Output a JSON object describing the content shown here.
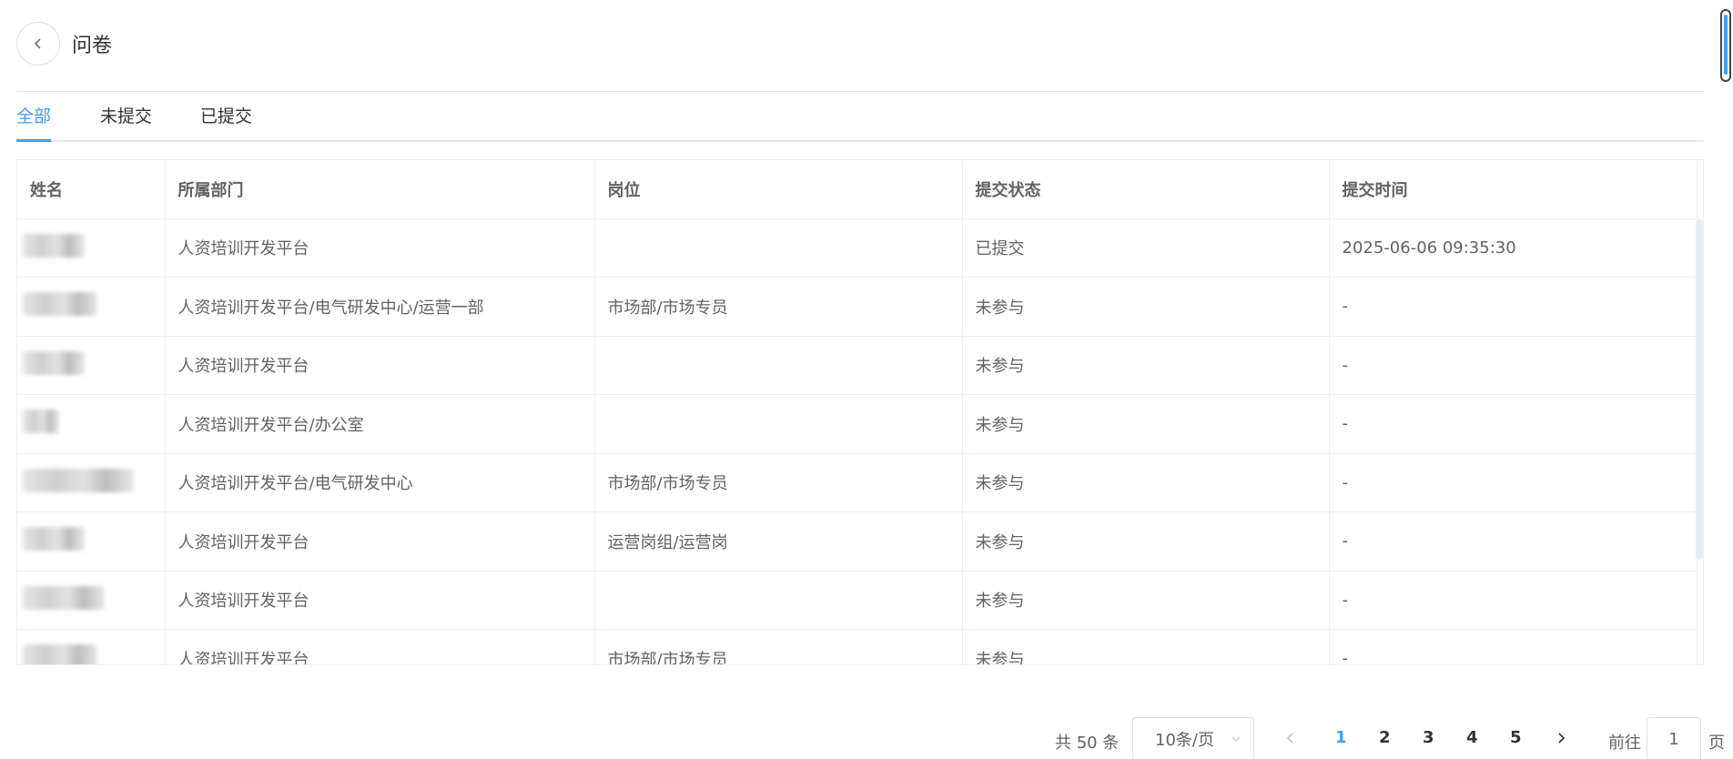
{
  "header": {
    "title": "问卷"
  },
  "tabs": [
    {
      "label": "全部",
      "active": true
    },
    {
      "label": "未提交",
      "active": false
    },
    {
      "label": "已提交",
      "active": false
    }
  ],
  "table": {
    "columns": [
      "姓名",
      "所属部门",
      "岗位",
      "提交状态",
      "提交时间"
    ],
    "rows": [
      {
        "name": "",
        "dept": "人资培训开发平台",
        "position": "",
        "status": "已提交",
        "time": "2025-06-06 09:35:30"
      },
      {
        "name": "",
        "dept": "人资培训开发平台/电气研发中心/运营一部",
        "position": "市场部/市场专员",
        "status": "未参与",
        "time": "-"
      },
      {
        "name": "",
        "dept": "人资培训开发平台",
        "position": "",
        "status": "未参与",
        "time": "-"
      },
      {
        "name": "",
        "dept": "人资培训开发平台/办公室",
        "position": "",
        "status": "未参与",
        "time": "-"
      },
      {
        "name": "",
        "dept": "人资培训开发平台/电气研发中心",
        "position": "市场部/市场专员",
        "status": "未参与",
        "time": "-"
      },
      {
        "name": "",
        "dept": "人资培训开发平台",
        "position": "运营岗组/运营岗",
        "status": "未参与",
        "time": "-"
      },
      {
        "name": "",
        "dept": "人资培训开发平台",
        "position": "",
        "status": "未参与",
        "time": "-"
      },
      {
        "name": "",
        "dept": "人资培训开发平台",
        "position": "市场部/市场专员",
        "status": "未参与",
        "time": "-"
      }
    ]
  },
  "pagination": {
    "total_text": "共 50 条",
    "page_size": "10条/页",
    "pages": [
      "1",
      "2",
      "3",
      "4",
      "5"
    ],
    "current_page": "1",
    "goto_label": "前往",
    "goto_value": "1",
    "goto_suffix": "页"
  },
  "colors": {
    "accent": "#409eff",
    "border": "#ebeef5",
    "text": "#606266"
  }
}
